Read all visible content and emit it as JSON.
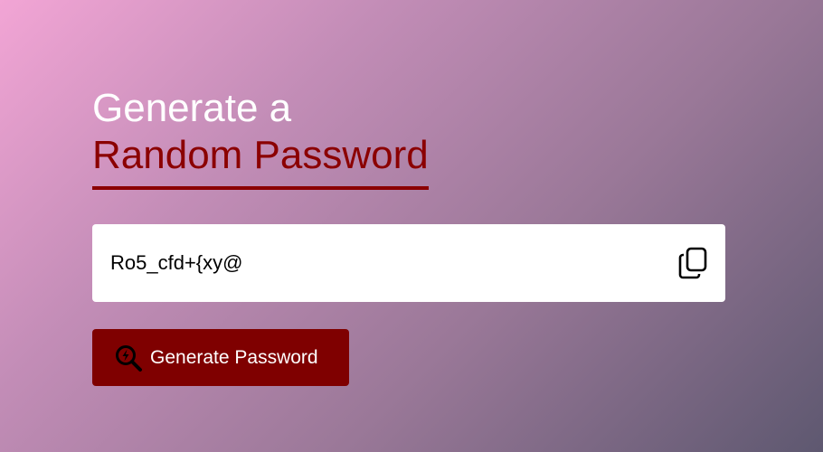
{
  "heading": {
    "line1": "Generate a",
    "line2": "Random Password"
  },
  "password": {
    "value": "Ro5_cfd+{xy@"
  },
  "icons": {
    "copy": "copy-icon",
    "generate": "search-lightning-icon"
  },
  "generate_button": {
    "label": "Generate Password"
  },
  "colors": {
    "accent": "#8b0000",
    "button_bg": "#7f0000",
    "gradient_start": "#f2a5d5",
    "gradient_end": "#5e5870"
  }
}
